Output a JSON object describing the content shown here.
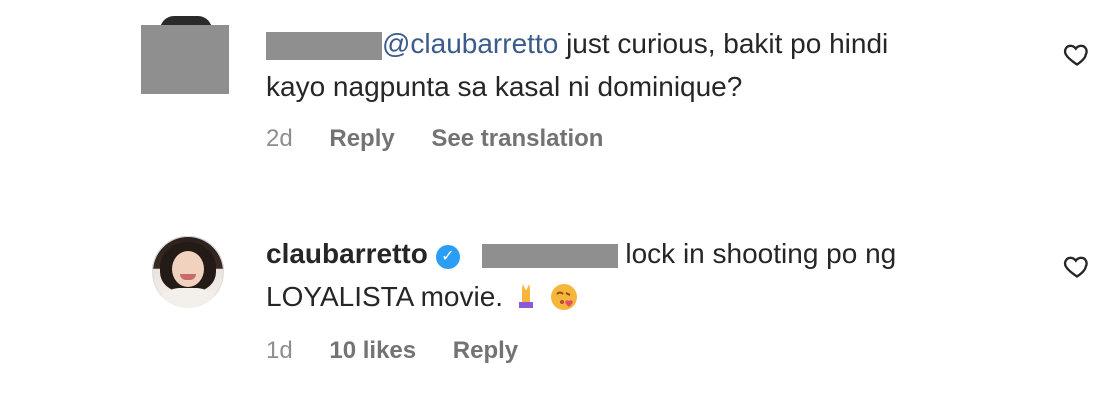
{
  "comments": [
    {
      "avatar": "redacted-avatar",
      "username": "",
      "mention": "@claubarretto",
      "text_line1": " just curious, bakit po hindi",
      "text_line2": "kayo nagpunta sa kasal ni dominique?",
      "time": "2d",
      "reply_label": "Reply",
      "translate_label": "See translation",
      "like_icon": "heart-icon"
    },
    {
      "avatar": "profile-photo",
      "username": "claubarretto",
      "verified": true,
      "text_line1": " lock in shooting po ng",
      "text_line2": "LOYALISTA movie.",
      "emojis": [
        "folded-hands-emoji",
        "face-blowing-kiss-emoji"
      ],
      "time": "1d",
      "likes": "10 likes",
      "reply_label": "Reply",
      "like_icon": "heart-icon"
    }
  ],
  "colors": {
    "mention": "#3b5b8c",
    "meta_text": "#8e8e8e",
    "verified_badge": "#2a9df4",
    "redaction": "#8f8f8f"
  }
}
